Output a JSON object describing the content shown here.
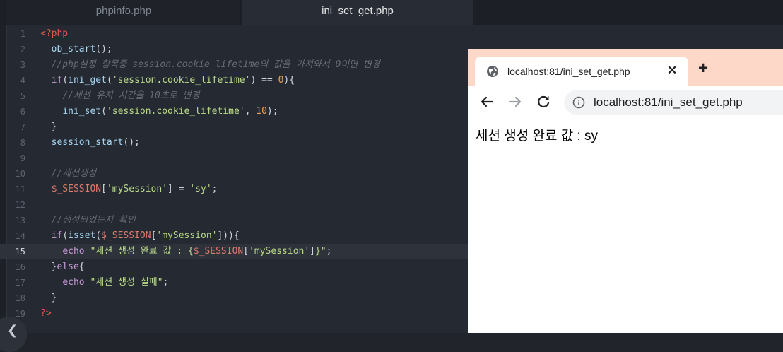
{
  "editor": {
    "tabs": [
      {
        "label": "phpinfo.php",
        "active": false
      },
      {
        "label": "ini_set_get.php",
        "active": true
      }
    ],
    "active_line": 15,
    "lines": [
      {
        "n": "1",
        "tokens": [
          {
            "c": "tag",
            "t": "<?php"
          }
        ]
      },
      {
        "n": "2",
        "tokens": [
          {
            "c": "p",
            "t": "  "
          },
          {
            "c": "fn",
            "t": "ob_start"
          },
          {
            "c": "p",
            "t": "();"
          }
        ]
      },
      {
        "n": "3",
        "tokens": [
          {
            "c": "p",
            "t": "  "
          },
          {
            "c": "cm",
            "t": "//php설정 항목중 session.cookie_lifetime의 값을 가져와서 0이면 변경"
          }
        ]
      },
      {
        "n": "4",
        "tokens": [
          {
            "c": "p",
            "t": "  "
          },
          {
            "c": "kw",
            "t": "if"
          },
          {
            "c": "p",
            "t": "("
          },
          {
            "c": "fn",
            "t": "ini_get"
          },
          {
            "c": "p",
            "t": "("
          },
          {
            "c": "str",
            "t": "'session.cookie_lifetime'"
          },
          {
            "c": "p",
            "t": ") == "
          },
          {
            "c": "num",
            "t": "0"
          },
          {
            "c": "p",
            "t": "){"
          }
        ]
      },
      {
        "n": "5",
        "tokens": [
          {
            "c": "p",
            "t": "    "
          },
          {
            "c": "cm",
            "t": "//세션 유지 시간을 10초로 변경"
          }
        ]
      },
      {
        "n": "6",
        "tokens": [
          {
            "c": "p",
            "t": "    "
          },
          {
            "c": "fn",
            "t": "ini_set"
          },
          {
            "c": "p",
            "t": "("
          },
          {
            "c": "str",
            "t": "'session.cookie_lifetime'"
          },
          {
            "c": "p",
            "t": ", "
          },
          {
            "c": "num",
            "t": "10"
          },
          {
            "c": "p",
            "t": ");"
          }
        ]
      },
      {
        "n": "7",
        "tokens": [
          {
            "c": "p",
            "t": "  }"
          }
        ]
      },
      {
        "n": "8",
        "tokens": [
          {
            "c": "p",
            "t": "  "
          },
          {
            "c": "fn",
            "t": "session_start"
          },
          {
            "c": "p",
            "t": "();"
          }
        ]
      },
      {
        "n": "9",
        "tokens": []
      },
      {
        "n": "10",
        "tokens": [
          {
            "c": "p",
            "t": "  "
          },
          {
            "c": "cm",
            "t": "//세션생성"
          }
        ]
      },
      {
        "n": "11",
        "tokens": [
          {
            "c": "p",
            "t": "  "
          },
          {
            "c": "var",
            "t": "$_SESSION"
          },
          {
            "c": "p",
            "t": "["
          },
          {
            "c": "str",
            "t": "'mySession'"
          },
          {
            "c": "p",
            "t": "] = "
          },
          {
            "c": "str",
            "t": "'sy'"
          },
          {
            "c": "p",
            "t": ";"
          }
        ]
      },
      {
        "n": "12",
        "tokens": []
      },
      {
        "n": "13",
        "tokens": [
          {
            "c": "p",
            "t": "  "
          },
          {
            "c": "cm",
            "t": "//생성되었는지 확인"
          }
        ]
      },
      {
        "n": "14",
        "tokens": [
          {
            "c": "p",
            "t": "  "
          },
          {
            "c": "kw",
            "t": "if"
          },
          {
            "c": "p",
            "t": "("
          },
          {
            "c": "fn",
            "t": "isset"
          },
          {
            "c": "p",
            "t": "("
          },
          {
            "c": "var",
            "t": "$_SESSION"
          },
          {
            "c": "p",
            "t": "["
          },
          {
            "c": "str",
            "t": "'mySession'"
          },
          {
            "c": "p",
            "t": "])){"
          }
        ]
      },
      {
        "n": "15",
        "tokens": [
          {
            "c": "p",
            "t": "    "
          },
          {
            "c": "kw",
            "t": "echo"
          },
          {
            "c": "p",
            "t": " "
          },
          {
            "c": "str",
            "t": "\"세션 생성 완료 값 : {"
          },
          {
            "c": "var",
            "t": "$_SESSION"
          },
          {
            "c": "p",
            "t": "["
          },
          {
            "c": "str",
            "t": "'mySession'"
          },
          {
            "c": "p",
            "t": "]"
          },
          {
            "c": "str",
            "t": "}\""
          },
          {
            "c": "p",
            "t": ";"
          }
        ]
      },
      {
        "n": "16",
        "tokens": [
          {
            "c": "p",
            "t": "  }"
          },
          {
            "c": "kw",
            "t": "else"
          },
          {
            "c": "p",
            "t": "{"
          }
        ]
      },
      {
        "n": "17",
        "tokens": [
          {
            "c": "p",
            "t": "    "
          },
          {
            "c": "kw",
            "t": "echo"
          },
          {
            "c": "p",
            "t": " "
          },
          {
            "c": "str",
            "t": "\"세션 생성 실패\""
          },
          {
            "c": "p",
            "t": ";"
          }
        ]
      },
      {
        "n": "18",
        "tokens": [
          {
            "c": "p",
            "t": "  }"
          }
        ]
      },
      {
        "n": "19",
        "tokens": [
          {
            "c": "tag",
            "t": "?>"
          }
        ]
      }
    ],
    "scroll_left_icon": "chevron-left-icon"
  },
  "browser": {
    "tab_title": "localhost:81/ini_set_get.php",
    "tab_icon": "globe-icon",
    "close_glyph": "✕",
    "new_tab_glyph": "+",
    "address": "localhost:81/ini_set_get.php",
    "page_text": "세션 생성 완료 값 : sy",
    "colors": {
      "tabstrip": "#fdd7c8",
      "omnibox": "#f1f3f4"
    }
  }
}
